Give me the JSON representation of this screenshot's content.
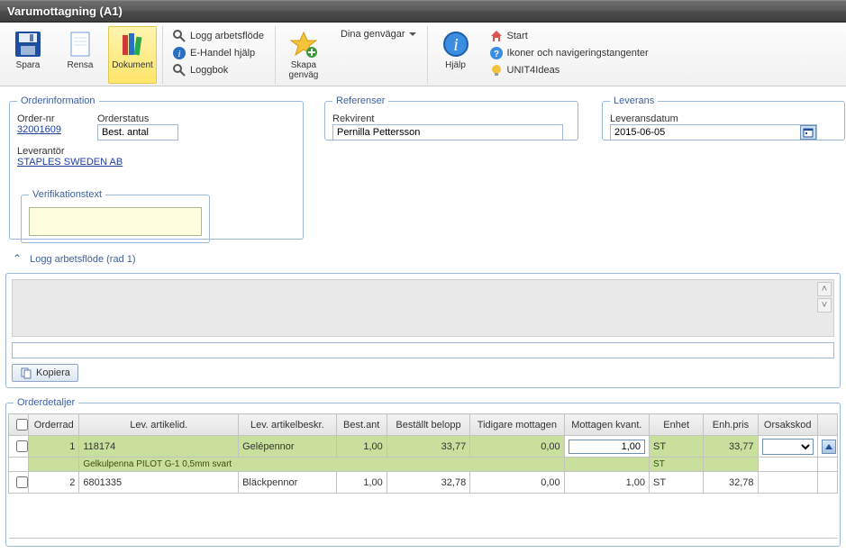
{
  "title": "Varumottagning (A1)",
  "ribbon": {
    "spara": "Spara",
    "rensa": "Rensa",
    "dokument": "Dokument",
    "logg_arbetsflode": "Logg arbetsflöde",
    "ehandel_hjalp": "E-Handel hjälp",
    "loggbok": "Loggbok",
    "skapa_genvag": "Skapa genväg",
    "dina_genvagar": "Dina genvägar",
    "hjalp": "Hjälp",
    "start": "Start",
    "ikoner": "Ikoner och navigeringstangenter",
    "unit4ideas": "UNIT4Ideas"
  },
  "order": {
    "legend": "Orderinformation",
    "order_nr_label": "Order-nr",
    "order_nr": "32001609",
    "orderstatus_label": "Orderstatus",
    "orderstatus": "Best. antal",
    "leverantor_label": "Leverantör",
    "leverantor": "STAPLES SWEDEN AB",
    "verif_legend": "Verifikationstext",
    "verif_text": ""
  },
  "refs": {
    "legend": "Referenser",
    "rekvirent_label": "Rekvirent",
    "rekvirent": "Pernilla Pettersson"
  },
  "leverans": {
    "legend": "Leverans",
    "datum_label": "Leveransdatum",
    "datum": "2015-06-05"
  },
  "log": {
    "header": "Logg arbetsflöde (rad 1)",
    "value": "",
    "kopiera": "Kopiera"
  },
  "details": {
    "legend": "Orderdetaljer",
    "cols": {
      "orderrad": "Orderrad",
      "lev_artid": "Lev. artikelid.",
      "lev_artbeskr": "Lev. artikelbeskr.",
      "best_ant": "Best.ant",
      "bestallt_belopp": "Beställt belopp",
      "tidigare": "Tidigare mottagen",
      "mottagen": "Mottagen kvant.",
      "enhet": "Enhet",
      "enh_pris": "Enh.pris",
      "orsak": "Orsakskod"
    },
    "rows": [
      {
        "orderrad": "1",
        "lev_artid": "118174",
        "lev_artid_sub": "Gelkulpenna PILOT G-1 0,5mm svart",
        "lev_artbeskr": "Gelépennor",
        "best_ant": "1,00",
        "bestallt_belopp": "33,77",
        "tidigare": "0,00",
        "mottagen": "1,00",
        "enhet": "ST",
        "enhet_sub": "ST",
        "enh_pris": "33,77",
        "orsak": "",
        "selected": true
      },
      {
        "orderrad": "2",
        "lev_artid": "6801335",
        "lev_artbeskr": "Bläckpennor",
        "best_ant": "1,00",
        "bestallt_belopp": "32,78",
        "tidigare": "0,00",
        "mottagen": "1,00",
        "enhet": "ST",
        "enh_pris": "32,78",
        "orsak": "",
        "selected": false
      }
    ]
  }
}
